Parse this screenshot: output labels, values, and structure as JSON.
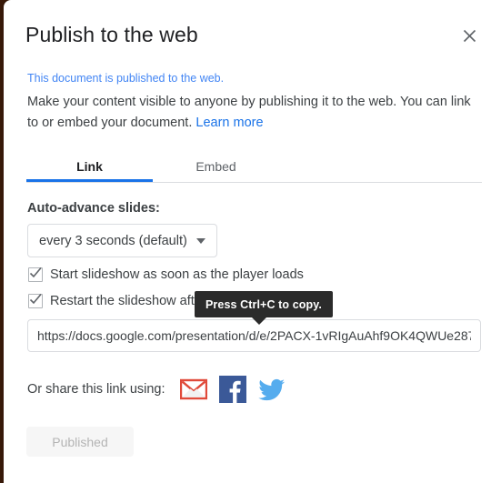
{
  "dialog": {
    "title": "Publish to the web",
    "close_icon": "close-icon"
  },
  "status": {
    "published_note": "This document is published to the web."
  },
  "description": {
    "text": "Make your content visible to anyone by publishing it to the web. You can link to or embed your document. ",
    "learn_more": "Learn more"
  },
  "tabs": [
    {
      "label": "Link",
      "active": true
    },
    {
      "label": "Embed",
      "active": false
    }
  ],
  "auto_advance": {
    "label": "Auto-advance slides:",
    "selected": "every 3 seconds (default)",
    "caret_icon": "chevron-down-icon"
  },
  "checkboxes": [
    {
      "label": "Start slideshow as soon as the player loads",
      "checked": true
    },
    {
      "label": "Restart the slideshow after the last slide",
      "checked": true
    }
  ],
  "url": {
    "value": "https://docs.google.com/presentation/d/e/2PACX-1vRIgAuAhf9OK4QWUe287"
  },
  "tooltip": {
    "text": "Press Ctrl+C to copy."
  },
  "share": {
    "label": "Or share this link using:",
    "icons": [
      "gmail-icon",
      "facebook-icon",
      "twitter-icon"
    ]
  },
  "footer": {
    "published_label": "Published"
  },
  "colors": {
    "accent_blue": "#1a73e8",
    "link_blue": "#4285f4",
    "text_primary": "#3c4043",
    "tooltip_bg": "#2b2b2b",
    "facebook_blue": "#3b5998",
    "twitter_blue": "#55acee",
    "gmail_red": "#e04a3a",
    "page_behind": "#3a1a09"
  }
}
